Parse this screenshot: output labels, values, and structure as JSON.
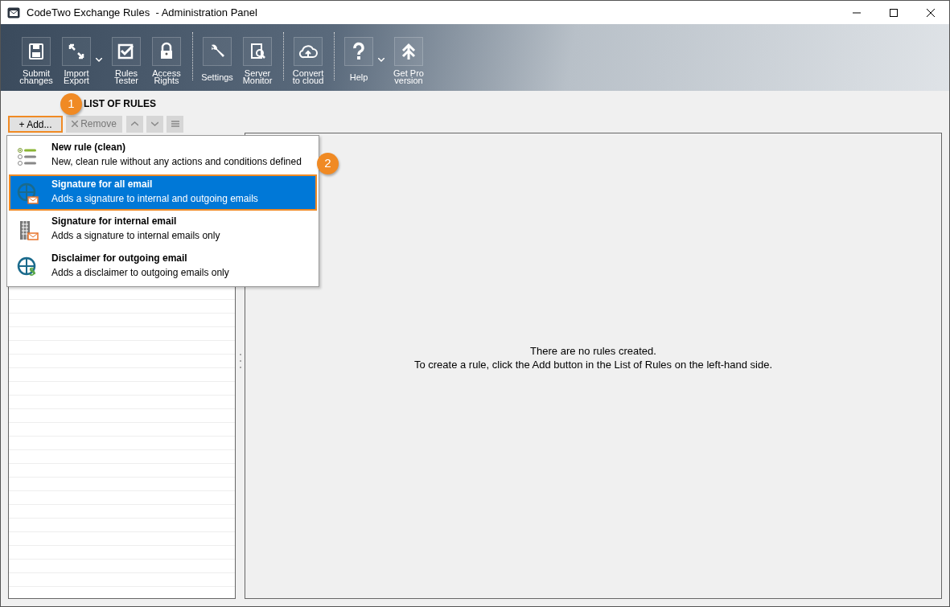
{
  "window": {
    "title": "CodeTwo Exchange Rules  - Administration Panel"
  },
  "toolbar": [
    {
      "kind": "button",
      "label": "Submit changes",
      "dropdown": false
    },
    {
      "kind": "button",
      "label": "Import Export",
      "dropdown": true
    },
    {
      "kind": "button",
      "label": "Rules Tester",
      "dropdown": false
    },
    {
      "kind": "button",
      "label": "Access Rights",
      "dropdown": false
    },
    {
      "kind": "separator"
    },
    {
      "kind": "button",
      "label": "Settings",
      "dropdown": false
    },
    {
      "kind": "button",
      "label": "Server Monitor",
      "dropdown": false
    },
    {
      "kind": "separator"
    },
    {
      "kind": "button",
      "label": "Convert to cloud",
      "dropdown": false
    },
    {
      "kind": "separator"
    },
    {
      "kind": "button",
      "label": "Help",
      "dropdown": true
    },
    {
      "kind": "button",
      "label": "Get Pro version",
      "dropdown": false
    }
  ],
  "list_panel": {
    "title": "LIST OF RULES",
    "add_button": "+ Add...",
    "remove_button": "Remove"
  },
  "add_menu": [
    {
      "title": "New rule (clean)",
      "description": "New, clean rule without any actions and conditions defined",
      "selected": false
    },
    {
      "title": "Signature for all email",
      "description": "Adds a signature to internal and outgoing emails",
      "selected": true
    },
    {
      "title": "Signature for internal email",
      "description": "Adds a signature to internal emails only",
      "selected": false
    },
    {
      "title": "Disclaimer for outgoing email",
      "description": "Adds a disclaimer to outgoing emails only",
      "selected": false
    }
  ],
  "callouts": [
    "1",
    "2"
  ],
  "empty_message": [
    "There are no rules created.",
    "To create a rule, click the Add button in the List of Rules on the left-hand side."
  ]
}
